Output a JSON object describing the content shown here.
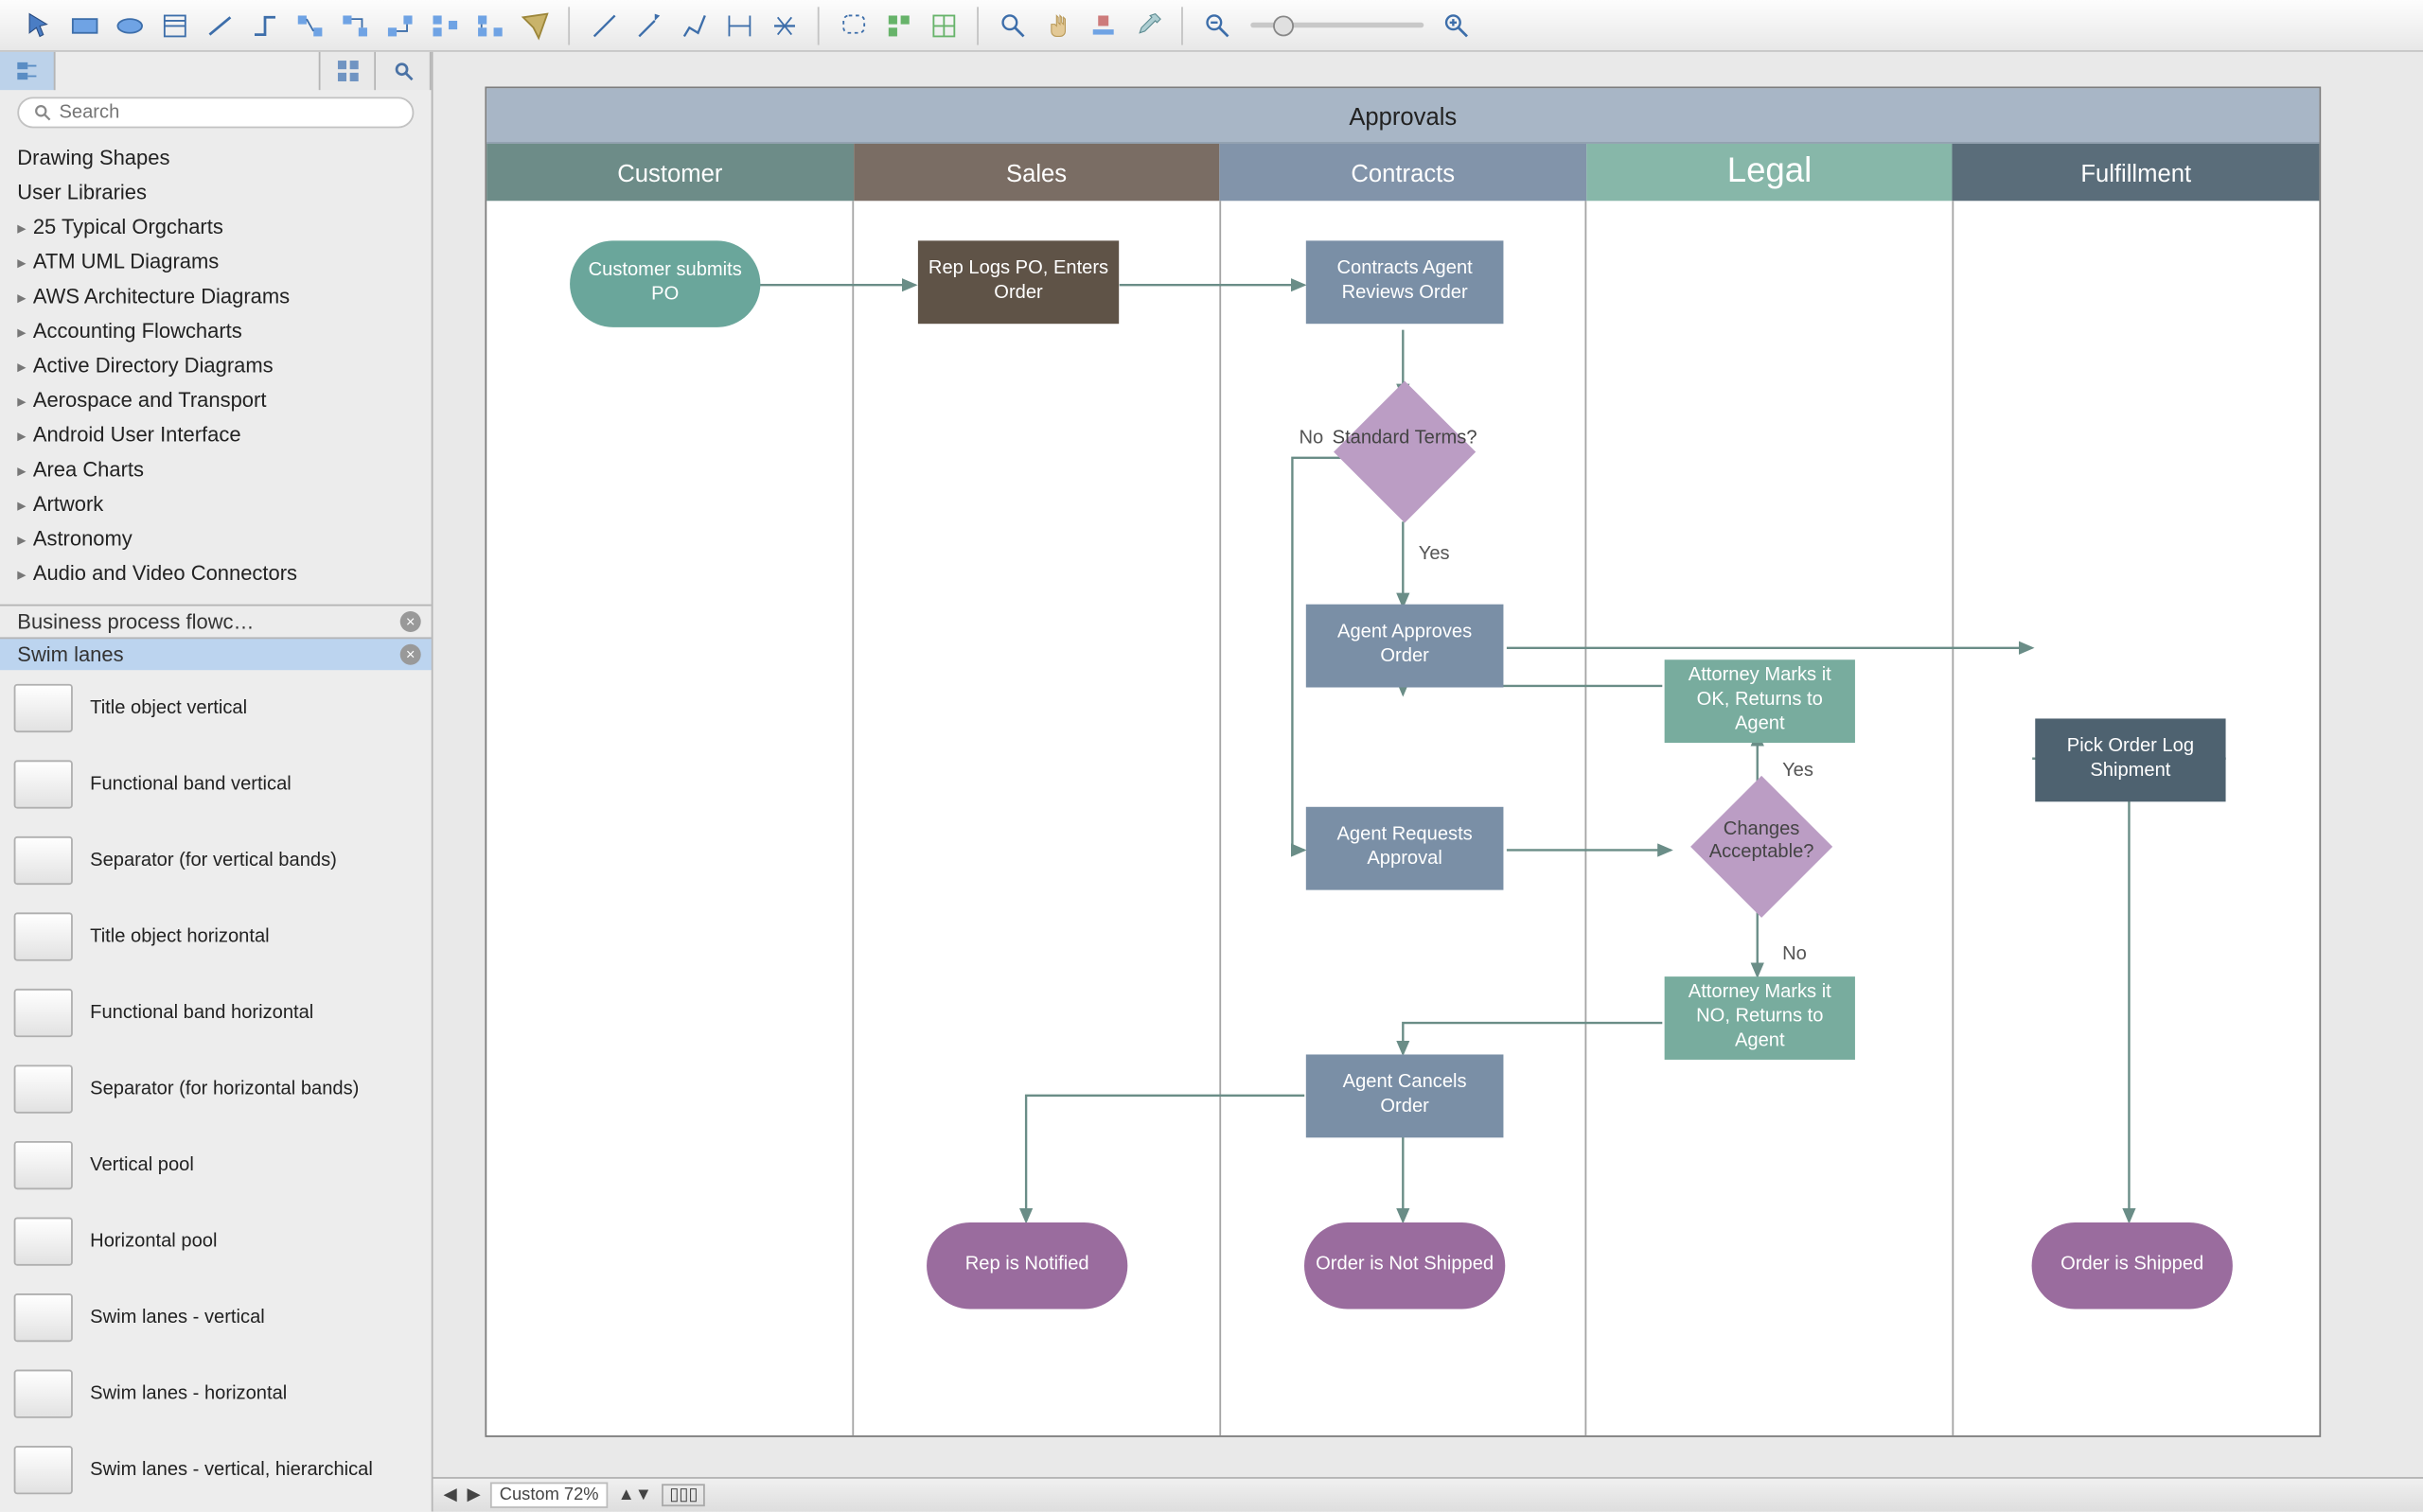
{
  "search": {
    "placeholder": "Search"
  },
  "sidebar": {
    "top_items": [
      "Drawing Shapes",
      "User Libraries"
    ],
    "categories": [
      "25 Typical Orgcharts",
      "ATM UML Diagrams",
      "AWS Architecture Diagrams",
      "Accounting Flowcharts",
      "Active Directory Diagrams",
      "Aerospace and Transport",
      "Android User Interface",
      "Area Charts",
      "Artwork",
      "Astronomy",
      "Audio and Video Connectors"
    ],
    "section_tabs": [
      "Business process flowc…",
      "Swim lanes"
    ],
    "shapes": [
      "Title object vertical",
      "Functional band vertical",
      "Separator (for vertical bands)",
      "Title object horizontal",
      "Functional band horizontal",
      "Separator (for horizontal bands)",
      "Vertical pool",
      "Horizontal pool",
      "Swim lanes - vertical",
      "Swim lanes - horizontal",
      "Swim lanes - vertical, hierarchical"
    ]
  },
  "diagram": {
    "title": "Approvals",
    "lanes": [
      "Customer",
      "Sales",
      "Contracts",
      "Legal",
      "Fulfillment"
    ],
    "nodes": {
      "customer_submit": "Customer submits PO",
      "rep_logs": "Rep Logs PO, Enters Order",
      "reviews": "Contracts Agent Reviews Order",
      "std_terms": "Standard Terms?",
      "approves": "Agent Approves Order",
      "requests": "Agent Requests Approval",
      "changes": "Changes Acceptable?",
      "att_ok": "Attorney Marks it OK, Returns to Agent",
      "att_no": "Attorney Marks it NO, Returns to Agent",
      "cancels": "Agent Cancels Order",
      "pick": "Pick Order Log Shipment",
      "rep_notified": "Rep is Notified",
      "not_shipped": "Order is Not Shipped",
      "shipped": "Order is Shipped"
    },
    "edge_labels": {
      "no1": "No",
      "yes1": "Yes",
      "yes2": "Yes",
      "no2": "No"
    }
  },
  "bottom": {
    "zoom_label": "Custom 72%"
  }
}
